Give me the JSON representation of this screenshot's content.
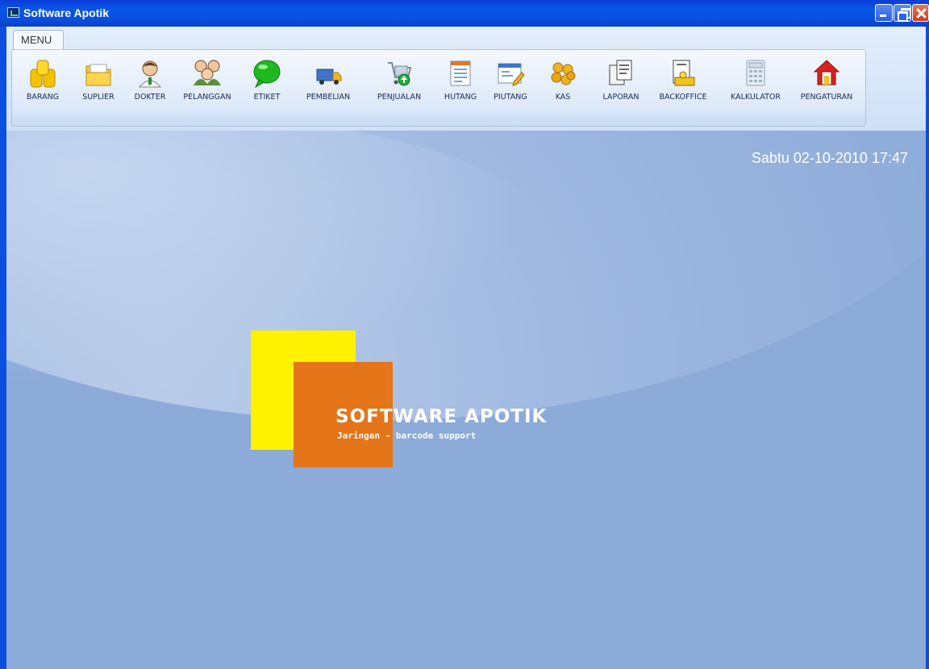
{
  "window": {
    "title": "Software Apotik"
  },
  "ribbon": {
    "tab_label": "MENU",
    "buttons": [
      {
        "label": "BARANG",
        "icon": "coins-stack-icon"
      },
      {
        "label": "SUPLIER",
        "icon": "folder-icon"
      },
      {
        "label": "DOKTER",
        "icon": "doctor-icon"
      },
      {
        "label": "PELANGGAN",
        "icon": "customers-icon"
      },
      {
        "label": "ETIKET",
        "icon": "speech-bubble-icon"
      },
      {
        "label": "PEMBELIAN",
        "icon": "delivery-truck-icon"
      },
      {
        "label": "PENJUALAN",
        "icon": "shopping-cart-icon"
      },
      {
        "label": "HUTANG",
        "icon": "ledger-icon"
      },
      {
        "label": "PIUTANG",
        "icon": "receivable-card-icon"
      },
      {
        "label": "KAS",
        "icon": "cash-coins-icon"
      },
      {
        "label": "LAPORAN",
        "icon": "report-documents-icon"
      },
      {
        "label": "BACKOFFICE",
        "icon": "backoffice-icon"
      },
      {
        "label": "KALKULATOR",
        "icon": "calculator-icon"
      },
      {
        "label": "PENGATURAN",
        "icon": "home-settings-icon"
      }
    ]
  },
  "status": {
    "datetime": "Sabtu  02-10-2010  17:47"
  },
  "splash": {
    "title": "SOFTWARE APOTIK",
    "subtitle": "Jaringan - barcode support"
  },
  "colors": {
    "titlebar": "#0b4fe0",
    "workspace": "#8cabd9",
    "logo_yellow": "#fff200",
    "logo_orange": "#e57519"
  }
}
